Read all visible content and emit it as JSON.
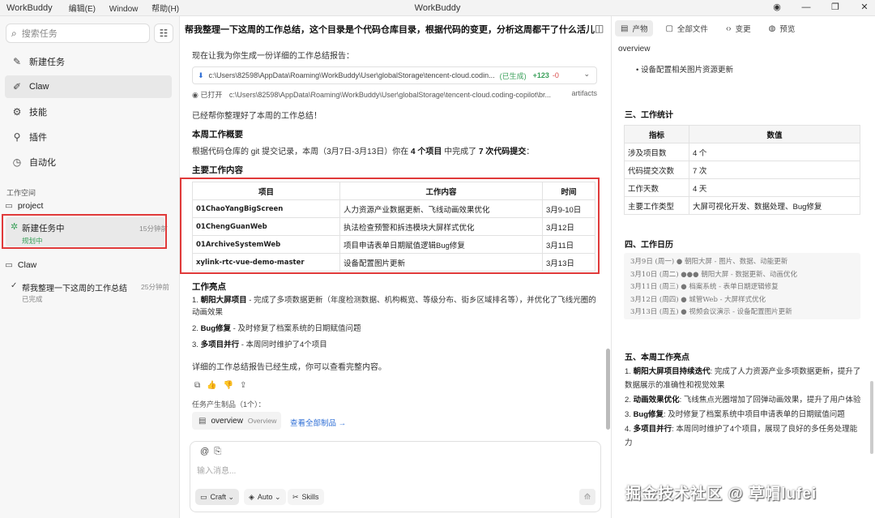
{
  "titlebar": {
    "app": "WorkBuddy",
    "menus": [
      "编辑(E)",
      "Window",
      "帮助(H)"
    ],
    "title": "WorkBuddy"
  },
  "sidebar": {
    "search_placeholder": "搜索任务",
    "items": [
      {
        "label": "新建任务",
        "icon": "edit-icon"
      },
      {
        "label": "Claw",
        "icon": "claw-icon"
      },
      {
        "label": "技能",
        "icon": "skills-icon"
      },
      {
        "label": "插件",
        "icon": "plugin-icon"
      },
      {
        "label": "自动化",
        "icon": "clock-icon"
      }
    ],
    "workspace_label": "工作空间",
    "project1": "project",
    "active_task": {
      "name": "新建任务中",
      "time": "15分钟前",
      "status": "规划中"
    },
    "project2": "Claw",
    "done_task": {
      "name": "帮我整理一下这周的工作总结",
      "time": "25分钟前",
      "status": "已完成"
    }
  },
  "main": {
    "title": "帮我整理一下这周的工作总结，这个目录是个代码仓库目录，根据代码的变更，分析这周都干了什么活儿",
    "intro": "现在让我为你生成一份详细的工作总结报告：",
    "file_path": "c:\\Users\\82598\\AppData\\Roaming\\WorkBuddy\\User\\globalStorage\\tencent-cloud.codin...",
    "file_status": "(已生成)",
    "file_add": "+123",
    "file_del": "-0",
    "opened_label": "已打开",
    "opened_path": "c:\\Users\\82598\\AppData\\Roaming\\WorkBuddy\\User\\globalStorage\\tencent-cloud.coding-copilot\\br...",
    "opened_tail": "artifacts",
    "done_msg": "已经帮你整理好了本周的工作总结！",
    "overview_heading": "本周工作概要",
    "summary_pre": "根据代码仓库的 git 提交记录，本周（3月7日-3月13日）你在 ",
    "summary_b1": "4 个项目",
    "summary_mid": " 中完成了 ",
    "summary_b2": "7 次代码提交",
    "summary_post": "：",
    "content_heading": "主要工作内容",
    "table_headers": [
      "项目",
      "工作内容",
      "时间"
    ],
    "table_rows": [
      [
        "01ChaoYangBigScreen",
        "人力资源产业数据更新、飞线动画效果优化",
        "3月9-10日"
      ],
      [
        "01ChengGuanWeb",
        "执法检查预警和拆违模块大屏样式优化",
        "3月12日"
      ],
      [
        "01ArchiveSystemWeb",
        "项目申请表单日期赋值逻辑Bug修复",
        "3月11日"
      ],
      [
        "xylink-rtc-vue-demo-master",
        "设备配置图片更新",
        "3月13日"
      ]
    ],
    "highlights_heading": "工作亮点",
    "highlights": [
      {
        "b": "朝阳大屏项目",
        "t": " - 完成了多项数据更新（年度检测数据、机构概览、等级分布、街乡区域排名等），并优化了飞线光圈的动画效果"
      },
      {
        "b": "Bug修复",
        "t": " - 及时修复了档案系统的日期赋值问题"
      },
      {
        "b": "多项目并行",
        "t": " - 本周同时维护了4个项目"
      }
    ],
    "footer": "详细的工作总结报告已经生成，你可以查看完整内容。",
    "artifacts_label": "任务产生制品（1个）：",
    "artifact_name": "overview",
    "artifact_sub": "Overview",
    "view_all": "查看全部制品 →",
    "input_placeholder": "输入消息...",
    "craft": "Craft",
    "auto": "Auto",
    "skills": "Skills"
  },
  "right": {
    "tabs": [
      {
        "label": "产物",
        "icon": "document-icon"
      },
      {
        "label": "全部文件",
        "icon": "file-icon"
      },
      {
        "label": "变更",
        "icon": "code-icon"
      },
      {
        "label": "预览",
        "icon": "globe-icon"
      }
    ],
    "doc_name": "overview",
    "bullet_top": "设备配置相关图片资源更新",
    "stats_heading": "三、工作统计",
    "stats_headers": [
      "指标",
      "数值"
    ],
    "stats_rows": [
      [
        "涉及项目数",
        "4 个"
      ],
      [
        "代码提交次数",
        "7 次"
      ],
      [
        "工作天数",
        "4 天"
      ],
      [
        "主要工作类型",
        "大屏可视化开发、数据处理、Bug修复"
      ]
    ],
    "cal_heading": "四、工作日历",
    "calendar": [
      "3月9日 (周一)  ●  朝阳大屏 - 图片、数据、动能更新",
      "3月10日 (周二) ●●● 朝阳大屏 - 数据更新、动画优化",
      "3月11日 (周三) ●  档案系统 - 表单日期逻辑修复",
      "3月12日 (周四) ●  城管Web - 大屏样式优化",
      "3月13日 (周五) ●  视频会议演示 - 设备配置图片更新"
    ],
    "hl_heading": "五、本周工作亮点",
    "highlights": [
      {
        "b": "朝阳大屏项目持续迭代",
        "t": ": 完成了人力资源产业多项数据更新，提升了数据展示的准确性和视觉效果"
      },
      {
        "b": "动画效果优化",
        "t": ": 飞线焦点光圈增加了回弹动画效果，提升了用户体验"
      },
      {
        "b": "Bug修复",
        "t": ": 及时修复了档案系统中项目申请表单的日期赋值问题"
      },
      {
        "b": "多项目并行",
        "t": ": 本周同时维护了4个项目，展现了良好的多任务处理能力"
      }
    ]
  },
  "watermark": "掘金技术社区 @ 草帽lufei"
}
